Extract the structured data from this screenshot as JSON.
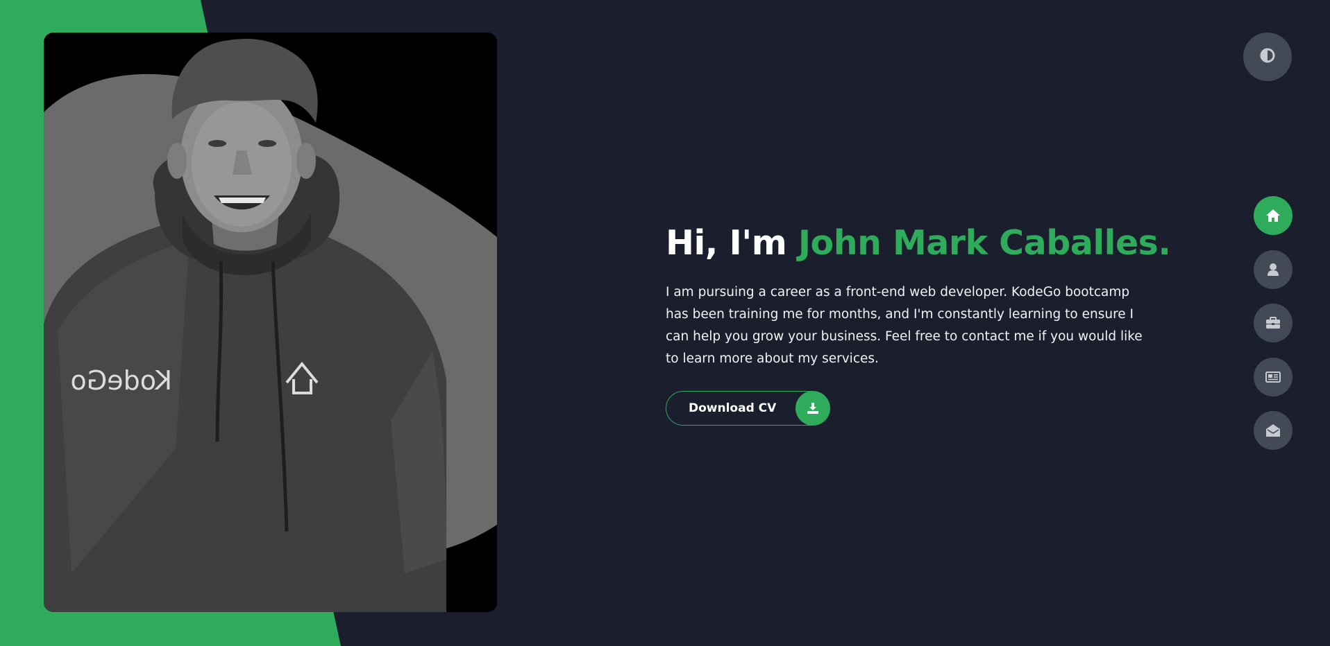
{
  "colors": {
    "background": "#1b1e2c",
    "accent": "#2fab5c",
    "button_gray": "#434a56",
    "text": "#ffffff"
  },
  "hero": {
    "greeting": "Hi, I'm ",
    "name": "John Mark Caballes.",
    "bio": "I am pursuing a career as a front-end web developer. KodeGo bootcamp has been training me for months, and I'm constantly learning to ensure I can help you grow your business. Feel free to contact me if you would like to learn more about my services.",
    "cta_label": "Download CV",
    "cta_icon": "download-icon"
  },
  "portrait": {
    "alt": "John Mark Caballes",
    "style": "grayscale",
    "hoodie_text": "KodeGo"
  },
  "theme_toggle": {
    "icon": "half-circle-contrast-icon"
  },
  "nav": {
    "items": [
      {
        "id": "home",
        "icon": "home-icon",
        "active": true
      },
      {
        "id": "about",
        "icon": "user-icon",
        "active": false
      },
      {
        "id": "portfolio",
        "icon": "briefcase-icon",
        "active": false
      },
      {
        "id": "blog",
        "icon": "newspaper-icon",
        "active": false
      },
      {
        "id": "contact",
        "icon": "envelope-open-icon",
        "active": false
      }
    ]
  }
}
